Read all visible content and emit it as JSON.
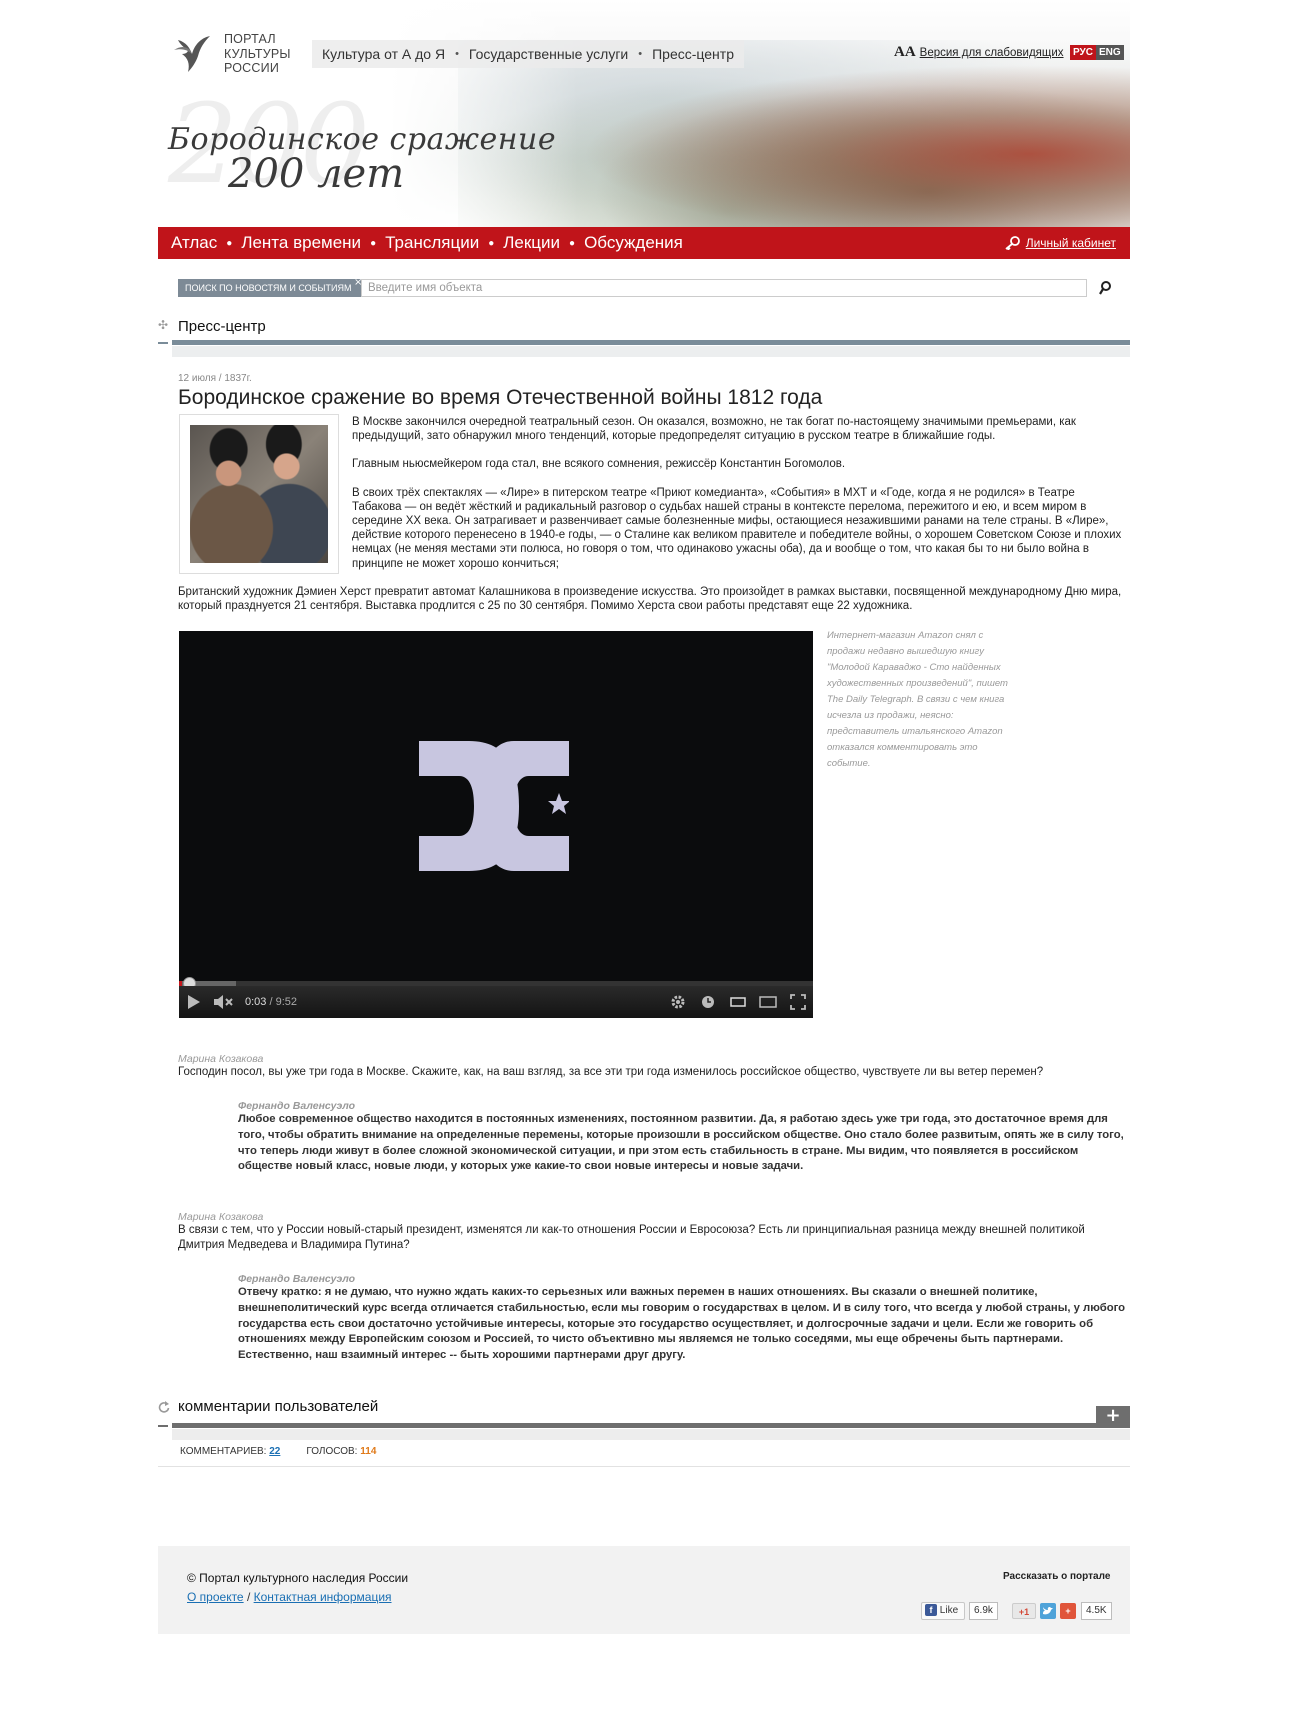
{
  "header": {
    "logo_lines": [
      "ПОРТАЛ",
      "КУЛЬТУРЫ",
      "РОССИИ"
    ],
    "topnav": [
      "Культура от А до Я",
      "Государственные услуги",
      "Пресс-центр"
    ],
    "accessibility_icon": "AA",
    "accessibility_label": "Версия для слабовидящих",
    "lang_ru": "РУС",
    "lang_en": "ENG",
    "banner_line1": "Бородинское сражение",
    "banner_line2": "200 лет",
    "banner_ghost": "200"
  },
  "mainnav": {
    "items": [
      "Атлас",
      "Лента времени",
      "Трансляции",
      "Лекции",
      "Обсуждения"
    ],
    "cabinet_label": "Личный кабинет"
  },
  "search": {
    "scope_label": "ПОИСК ПО НОВОСТЯМ И СОБЫТИЯМ",
    "close_symbol": "×",
    "placeholder": "Введите имя объекта"
  },
  "section": {
    "title": "Пресс-центр"
  },
  "article": {
    "date": "12 июля / 1837г.",
    "title": "Бородинское сражение во время Отечественной войны 1812 года",
    "paragraphs": [
      "В Москве закончился очередной театральный сезон. Он оказался, возможно, не так богат по-настоящему значимыми премьерами, как предыдущий, зато обнаружил много тенденций, которые предопределят ситуацию в русском театре в ближайшие годы.",
      "Главным ньюсмейкером года стал, вне всякого сомнения, режиссёр Константин Богомолов.",
      "В своих трёх спектаклях — «Лире» в питерском театре «Приют комедианта», «События» в МХТ и «Годе, когда я не родился» в Театре Табакова — он ведёт жёсткий и радикальный разговор о судьбах нашей страны в контексте перелома, пережитого и ею, и всем миром в середине XX века. Он затрагивает и развенчивает самые болезненные мифы, остающиеся незажившими ранами на теле страны. В «Лире», действие которого перенесено в 1940-е годы, — о Сталине как великом правителе и победителе войны, о хорошем Советском Союзе и плохих немцах (не меняя местами эти полюса, но говоря о том, что одинаково ужасны оба), да и вообще о том, что какая бы то ни было война в принципе не может хорошо кончиться;"
    ],
    "paragraph_after": "Британский художник Дэмиен Херст превратит автомат Калашникова в произведение искусства. Это произойдет в рамках выставки, посвященной международному Дню мира, который празднуется 21 сентября. Выставка продлится с 25 по 30 сентября. Помимо Херста свои работы представят еще 22 художника."
  },
  "video": {
    "current_time": "0:03",
    "separator": " / ",
    "duration": "9:52",
    "progress_fraction": 0.005,
    "buffered_fraction": 0.09,
    "logo_text": "DC"
  },
  "sidenote": "Интернет-магазин Amazon снял с продажи недавно вышедшую книгу \"Молодой Караваджо - Сто найденных художественных произведений\", пишет The Daily Telegraph. В связи с чем книга исчезла из продажи, неясно: представитель итальянского Amazon отказался комментировать это событие.",
  "interview": [
    {
      "q_author": "Марина Козакова",
      "question": "Господин посол, вы уже три года в Москве. Скажите, как, на ваш взгляд, за все эти три года изменилось российское общество, чувствуете ли вы ветер перемен?",
      "a_author": "Фернандо Валенсуэло",
      "answer": "Любое современное общество находится в постоянных изменениях, постоянном развитии. Да, я работаю здесь уже три года, это достаточное время для того, чтобы обратить внимание на определенные перемены, которые произошли в российском обществе. Оно стало более развитым, опять же в силу того, что теперь люди живут в более сложной экономической ситуации, и при этом есть стабильность в стране. Мы видим, что появляется в российском обществе новый класс, новые люди, у которых уже какие-то свои новые интересы и новые задачи."
    },
    {
      "q_author": "Марина Козакова",
      "question": "В связи с тем, что у России новый-старый президент, изменятся ли как-то отношения России и Евросоюза? Есть ли принципиальная разница между внешней политикой Дмитрия Медведева и Владимира Путина?",
      "a_author": "Фернандо Валенсуэло",
      "answer": "Отвечу кратко: я не думаю, что нужно ждать каких-то серьезных или важных перемен в наших отношениях. Вы сказали о внешней политике, внешнеполитический курс всегда отличается стабильностью, если мы говорим о государствах в целом. И в силу того, что всегда у любой страны, у любого государства есть свои достаточно устойчивые интересы, которые это государство осуществляет, и долгосрочные задачи и цели. Если же говорить об отношениях между Европейским союзом и Россией, то чисто объективно мы являемся не только соседями, мы еще обречены быть партнерами. Естественно, наш взаимный интерес -- быть хорошими партнерами друг другу."
    }
  ],
  "comments": {
    "title": "комментарии пользователей",
    "add_symbol": "+",
    "comments_label": "КОММЕНТАРИЕВ:",
    "comments_count": "22",
    "votes_label": "ГОЛОСОВ:",
    "votes_count": "114"
  },
  "footer": {
    "copyright": "© Портал культурного наследия России",
    "link_about": "О проекте",
    "link_separator": " / ",
    "link_contacts": "Контактная информация",
    "share_title": "Рассказать о портале",
    "fb_label": "Like",
    "fb_count": "6.9k",
    "gplus_label": "+1",
    "share_count": "4.5K"
  },
  "colors": {
    "brand_red": "#c0141a",
    "section_bar": "#7a8c99",
    "link_blue": "#1a6fb3",
    "votes_orange": "#e07a1a"
  }
}
